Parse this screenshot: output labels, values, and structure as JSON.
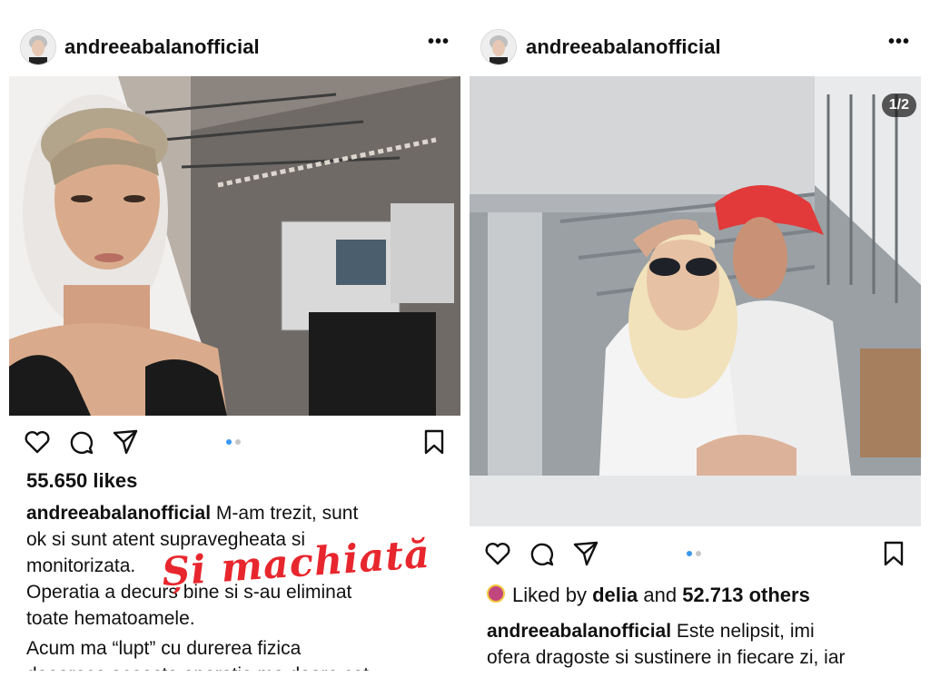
{
  "posts": [
    {
      "username": "andreeabalanofficial",
      "more_icon": "more-options-icon",
      "likes": "55.650 likes",
      "caption_user": "andreeabalanofficial",
      "caption_lines": [
        "M-am trezit, sunt",
        "ok si sunt atent supravegheata si",
        "monitorizata.",
        "Operatia a decurs bine si s-au eliminat",
        "toate hematoamele.",
        "Acum ma “lupt” cu durerea fizica",
        "deoarece aceasta operatie ma doare cat"
      ],
      "overlay_text": "Și machiată",
      "overlay_color": "#e8262d",
      "carousel_active": 0
    },
    {
      "username": "andreeabalanofficial",
      "more_icon": "more-options-icon",
      "photo_counter": "1/2",
      "liked_prefix": "Liked by",
      "liked_user": "delia",
      "liked_and": "and",
      "liked_others": "52.713 others",
      "caption_user": "andreeabalanofficial",
      "caption_lines": [
        "Este nelipsit, imi",
        "ofera dragoste si sustinere in fiecare zi, iar"
      ],
      "carousel_active": 0
    }
  ],
  "colors": {
    "carousel_active": "#3897f0",
    "carousel_inactive": "#c7c7c7",
    "text": "#111111"
  }
}
